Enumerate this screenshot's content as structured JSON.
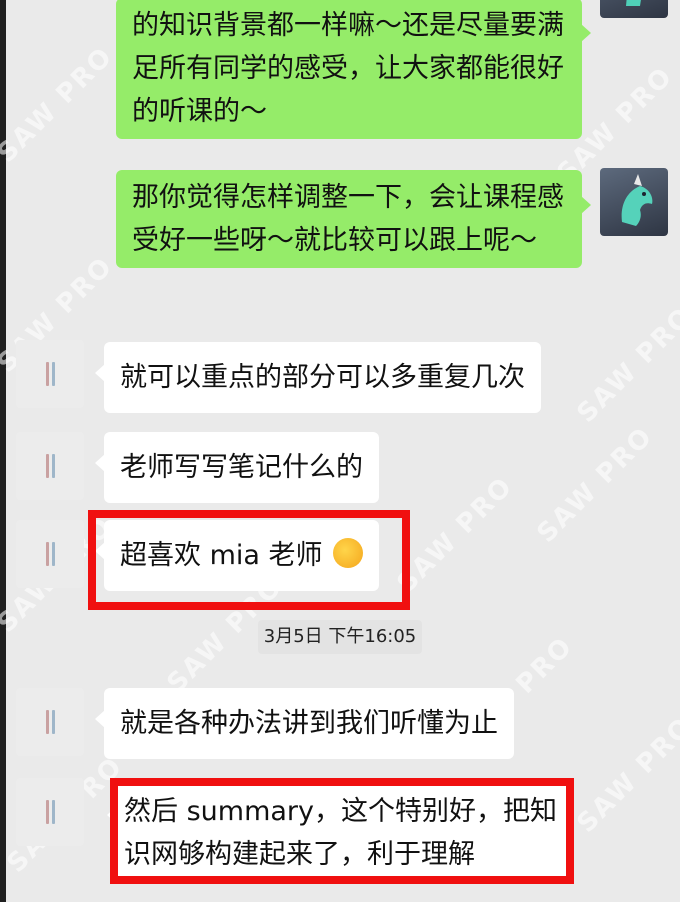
{
  "watermark": "SAW PRO",
  "timestamp": "3月5日 下午16:05",
  "messages": [
    {
      "side": "right",
      "text": "的知识背景都一样嘛～还是尽量要满足所有同学的感受，让大家都能很好的听课的～"
    },
    {
      "side": "right",
      "text": "那你觉得怎样调整一下，会让课程感受好一些呀～就比较可以跟上呢～"
    },
    {
      "side": "left",
      "text": "就可以重点的部分可以多重复几次"
    },
    {
      "side": "left",
      "text": "老师写写笔记什么的"
    },
    {
      "side": "left",
      "text": "超喜欢 mia 老师",
      "emoji": "thinking-face"
    },
    {
      "side": "left",
      "text": "就是各种办法讲到我们听懂为止"
    },
    {
      "side": "left",
      "text": "然后 summary，这个特别好，把知识网够构建起来了，利于理解"
    }
  ],
  "highlight_color": "#f01010",
  "bubble_colors": {
    "sent": "#95ec69",
    "received": "#ffffff"
  }
}
